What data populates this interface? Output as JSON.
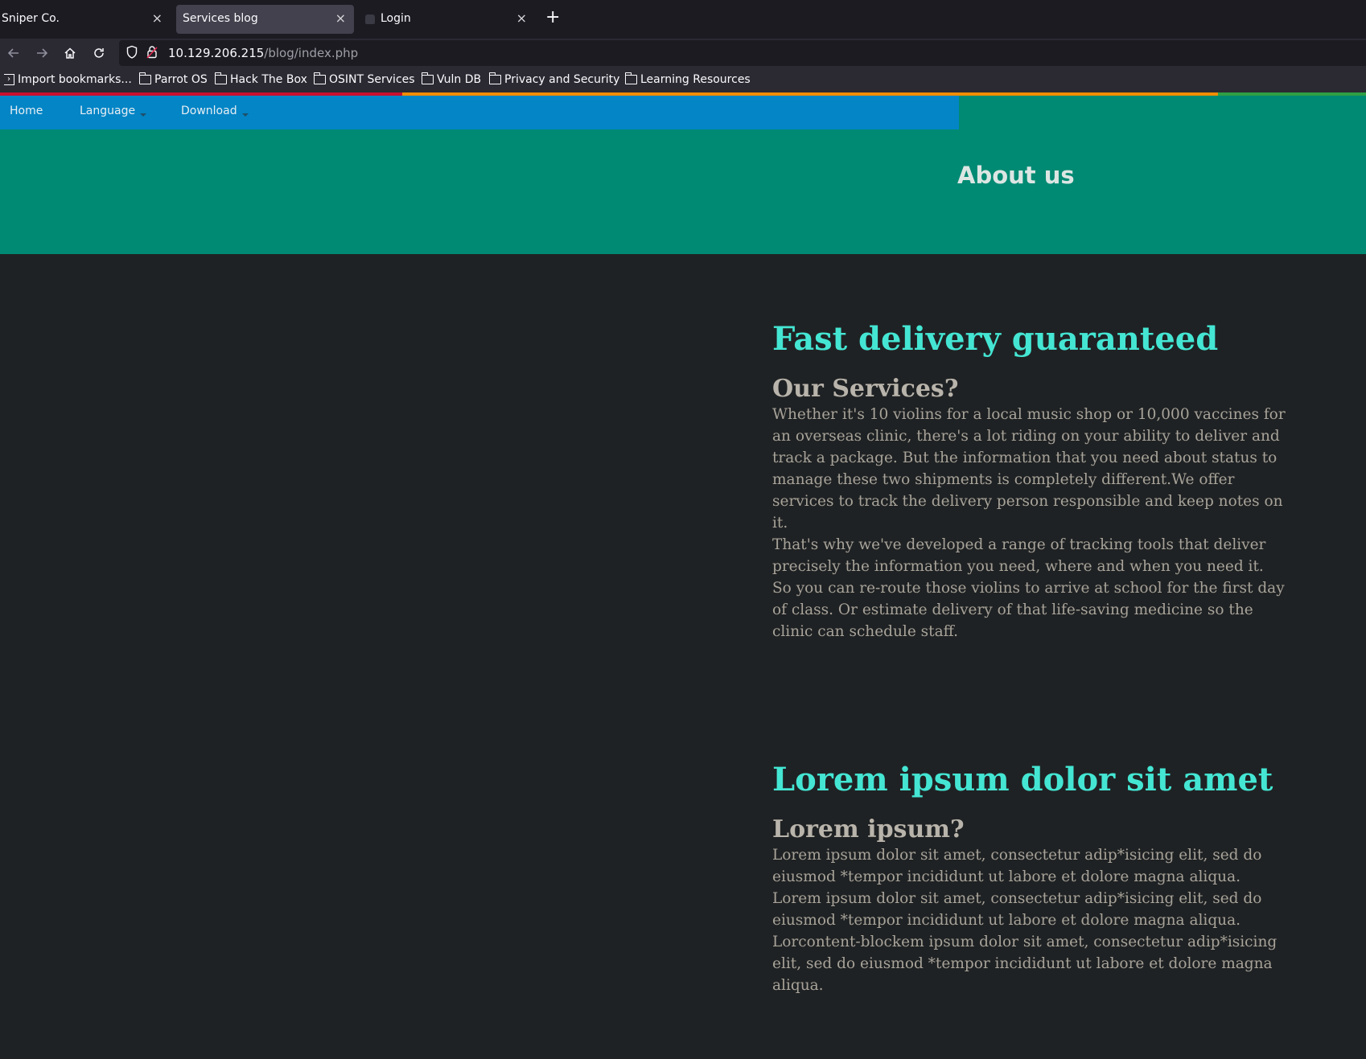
{
  "browser": {
    "tabs": [
      {
        "title": "Sniper Co.",
        "close": "×"
      },
      {
        "title": "Services blog",
        "close": "×",
        "active": true
      },
      {
        "title": "Login",
        "close": "×"
      }
    ],
    "new_tab": "+",
    "nav_icons": [
      "back-icon",
      "forward-icon",
      "home-icon",
      "reload-icon"
    ],
    "url": {
      "host": "10.129.206.215",
      "path": "/blog/index.php"
    },
    "bookmarks": [
      "Import bookmarks...",
      "Parrot OS",
      "Hack The Box",
      "OSINT Services",
      "Vuln DB",
      "Privacy and Security",
      "Learning Resources"
    ],
    "strip_colors": [
      "#c8102e",
      "#f08c00",
      "#2f9e44"
    ]
  },
  "site": {
    "nav": {
      "home": "Home",
      "language": "Language",
      "download": "Download"
    },
    "hero_title": "About us",
    "sections": [
      {
        "title": "Fast delivery guaranteed",
        "subtitle": "Our Services?",
        "paragraph1": "Whether it's 10 violins for a local music shop or 10,000 vaccines for an overseas clinic, there's a lot riding on your ability to deliver and track a package. But the information that you need about status to manage these two shipments is completely different.We offer services to track the delivery person responsible and keep notes on it.",
        "paragraph2": "That's why we've developed a range of tracking tools that deliver precisely the information you need, where and when you need it. So you can re-route those violins to arrive at school for the first day of class. Or estimate delivery of that life-saving medicine so the clinic can schedule staff."
      },
      {
        "title": "Lorem ipsum dolor sit amet",
        "subtitle": "Lorem ipsum?",
        "paragraph1": "Lorem ipsum dolor sit amet, consectetur adip*isicing elit, sed do eiusmod *tempor incididunt ut labore et dolore magna aliqua. Lorem ipsum dolor sit amet, consectetur adip*isicing elit, sed do eiusmod *tempor incididunt ut labore et dolore magna aliqua.",
        "paragraph2": "Lorcontent-blockem ipsum dolor sit amet, consectetur adip*isicing elit, sed do eiusmod *tempor incididunt ut labore et dolore magna aliqua."
      }
    ]
  },
  "colors": {
    "nav_bar": "#0385c6",
    "hero": "#008a73",
    "page_bg": "#1f2224",
    "heading": "#44e6d3"
  }
}
